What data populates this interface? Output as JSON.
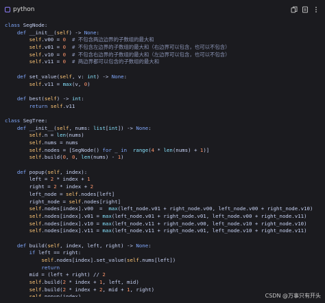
{
  "header": {
    "language": "python",
    "icons": [
      "copy-icon",
      "expand-icon",
      "more-icon"
    ]
  },
  "code": {
    "lines": [
      [
        [
          "kw",
          "class"
        ],
        [
          "t",
          " SegNode:"
        ]
      ],
      [
        [
          "t",
          "    "
        ],
        [
          "kw",
          "def"
        ],
        [
          "t",
          " __init__("
        ],
        [
          "self",
          "self"
        ],
        [
          "t",
          ") -> "
        ],
        [
          "kw",
          "None"
        ],
        [
          "t",
          ":"
        ]
      ],
      [
        [
          "t",
          "        "
        ],
        [
          "self",
          "self"
        ],
        [
          "t",
          ".v00 = "
        ],
        [
          "num",
          "0"
        ],
        [
          "t",
          "  "
        ],
        [
          "cmt",
          "# 不包含两边边界的子数组的最大和"
        ]
      ],
      [
        [
          "t",
          "        "
        ],
        [
          "self",
          "self"
        ],
        [
          "t",
          ".v01 = "
        ],
        [
          "num",
          "0"
        ],
        [
          "t",
          "  "
        ],
        [
          "cmt",
          "# 不包含左边界的子数组的最大和（右边界可以包含，也可以不包含）"
        ]
      ],
      [
        [
          "t",
          "        "
        ],
        [
          "self",
          "self"
        ],
        [
          "t",
          ".v10 = "
        ],
        [
          "num",
          "0"
        ],
        [
          "t",
          "  "
        ],
        [
          "cmt",
          "# 不包含右边界的子数组的最大和（左边界可以包含，也可以不包含）"
        ]
      ],
      [
        [
          "t",
          "        "
        ],
        [
          "self",
          "self"
        ],
        [
          "t",
          ".v11 = "
        ],
        [
          "num",
          "0"
        ],
        [
          "t",
          "  "
        ],
        [
          "cmt",
          "# 两边界都可以包含的子数组的最大和"
        ]
      ],
      [],
      [
        [
          "t",
          "    "
        ],
        [
          "kw",
          "def"
        ],
        [
          "t",
          " set_value("
        ],
        [
          "self",
          "self"
        ],
        [
          "t",
          ", v: "
        ],
        [
          "bi",
          "int"
        ],
        [
          "t",
          ") -> "
        ],
        [
          "kw",
          "None"
        ],
        [
          "t",
          ":"
        ]
      ],
      [
        [
          "t",
          "        "
        ],
        [
          "self",
          "self"
        ],
        [
          "t",
          ".v11 = "
        ],
        [
          "bi",
          "max"
        ],
        [
          "t",
          "(v, "
        ],
        [
          "num",
          "0"
        ],
        [
          "t",
          ")"
        ]
      ],
      [],
      [
        [
          "t",
          "    "
        ],
        [
          "kw",
          "def"
        ],
        [
          "t",
          " best("
        ],
        [
          "self",
          "self"
        ],
        [
          "t",
          ") -> "
        ],
        [
          "bi",
          "int"
        ],
        [
          "t",
          ":"
        ]
      ],
      [
        [
          "t",
          "        "
        ],
        [
          "kw",
          "return"
        ],
        [
          "t",
          " "
        ],
        [
          "self",
          "self"
        ],
        [
          "t",
          ".v11"
        ]
      ],
      [],
      [
        [
          "kw",
          "class"
        ],
        [
          "t",
          " SegTree:"
        ]
      ],
      [
        [
          "t",
          "    "
        ],
        [
          "kw",
          "def"
        ],
        [
          "t",
          " __init__("
        ],
        [
          "self",
          "self"
        ],
        [
          "t",
          ", nums: "
        ],
        [
          "bi",
          "list"
        ],
        [
          "t",
          "["
        ],
        [
          "bi",
          "int"
        ],
        [
          "t",
          "]) -> "
        ],
        [
          "kw",
          "None"
        ],
        [
          "t",
          ":"
        ]
      ],
      [
        [
          "t",
          "        "
        ],
        [
          "self",
          "self"
        ],
        [
          "t",
          ".n = "
        ],
        [
          "bi",
          "len"
        ],
        [
          "t",
          "(nums)"
        ]
      ],
      [
        [
          "t",
          "        "
        ],
        [
          "self",
          "self"
        ],
        [
          "t",
          ".nums = nums"
        ]
      ],
      [
        [
          "t",
          "        "
        ],
        [
          "self",
          "self"
        ],
        [
          "t",
          ".nodes = [SegNode() "
        ],
        [
          "kw",
          "for"
        ],
        [
          "t",
          " _ "
        ],
        [
          "kw",
          "in"
        ],
        [
          "t",
          "  "
        ],
        [
          "bi",
          "range"
        ],
        [
          "t",
          "("
        ],
        [
          "num",
          "4"
        ],
        [
          "t",
          " * "
        ],
        [
          "bi",
          "len"
        ],
        [
          "t",
          "(nums) + "
        ],
        [
          "num",
          "1"
        ],
        [
          "t",
          ")]"
        ]
      ],
      [
        [
          "t",
          "        "
        ],
        [
          "self",
          "self"
        ],
        [
          "t",
          ".build("
        ],
        [
          "num",
          "0"
        ],
        [
          "t",
          ", "
        ],
        [
          "num",
          "0"
        ],
        [
          "t",
          ", "
        ],
        [
          "bi",
          "len"
        ],
        [
          "t",
          "(nums) - "
        ],
        [
          "num",
          "1"
        ],
        [
          "t",
          ")"
        ]
      ],
      [],
      [
        [
          "t",
          "    "
        ],
        [
          "kw",
          "def"
        ],
        [
          "t",
          " popup("
        ],
        [
          "self",
          "self"
        ],
        [
          "t",
          ", index):"
        ]
      ],
      [
        [
          "t",
          "        left = "
        ],
        [
          "num",
          "2"
        ],
        [
          "t",
          " * index + "
        ],
        [
          "num",
          "1"
        ]
      ],
      [
        [
          "t",
          "        right = "
        ],
        [
          "num",
          "2"
        ],
        [
          "t",
          " * index + "
        ],
        [
          "num",
          "2"
        ]
      ],
      [
        [
          "t",
          "        left_node = "
        ],
        [
          "self",
          "self"
        ],
        [
          "t",
          ".nodes[left]"
        ]
      ],
      [
        [
          "t",
          "        right_node = "
        ],
        [
          "self",
          "self"
        ],
        [
          "t",
          ".nodes[right]"
        ]
      ],
      [
        [
          "t",
          "        "
        ],
        [
          "self",
          "self"
        ],
        [
          "t",
          ".nodes[index].v00  =  "
        ],
        [
          "bi",
          "max"
        ],
        [
          "t",
          "(left_node.v01 + right_node.v00, left_node.v00 + right_node.v10)"
        ]
      ],
      [
        [
          "t",
          "        "
        ],
        [
          "self",
          "self"
        ],
        [
          "t",
          ".nodes[index].v01 = "
        ],
        [
          "bi",
          "max"
        ],
        [
          "t",
          "(left_node.v01 + right_node.v01, left_node.v00 + right_node.v11)"
        ]
      ],
      [
        [
          "t",
          "        "
        ],
        [
          "self",
          "self"
        ],
        [
          "t",
          ".nodes[index].v10 = "
        ],
        [
          "bi",
          "max"
        ],
        [
          "t",
          "(left_node.v11 + right_node.v00, left_node.v10 + right_node.v10)"
        ]
      ],
      [
        [
          "t",
          "        "
        ],
        [
          "self",
          "self"
        ],
        [
          "t",
          ".nodes[index].v11 = "
        ],
        [
          "bi",
          "max"
        ],
        [
          "t",
          "(left_node.v11 + right_node.v01, left_node.v10 + right_node.v11)"
        ]
      ],
      [],
      [
        [
          "t",
          "    "
        ],
        [
          "kw",
          "def"
        ],
        [
          "t",
          " build("
        ],
        [
          "self",
          "self"
        ],
        [
          "t",
          ", index, left, right) -> "
        ],
        [
          "kw",
          "None"
        ],
        [
          "t",
          ":"
        ]
      ],
      [
        [
          "t",
          "        "
        ],
        [
          "kw",
          "if"
        ],
        [
          "t",
          " left == right:"
        ]
      ],
      [
        [
          "t",
          "            "
        ],
        [
          "self",
          "self"
        ],
        [
          "t",
          ".nodes[index].set_value("
        ],
        [
          "self",
          "self"
        ],
        [
          "t",
          ".nums[left])"
        ]
      ],
      [
        [
          "t",
          "            "
        ],
        [
          "kw",
          "return"
        ]
      ],
      [
        [
          "t",
          "        mid = (left + right) // "
        ],
        [
          "num",
          "2"
        ]
      ],
      [
        [
          "t",
          "        "
        ],
        [
          "self",
          "self"
        ],
        [
          "t",
          ".build("
        ],
        [
          "num",
          "2"
        ],
        [
          "t",
          " * index + "
        ],
        [
          "num",
          "1"
        ],
        [
          "t",
          ", left, mid)"
        ]
      ],
      [
        [
          "t",
          "        "
        ],
        [
          "self",
          "self"
        ],
        [
          "t",
          ".build("
        ],
        [
          "num",
          "2"
        ],
        [
          "t",
          " * index + "
        ],
        [
          "num",
          "2"
        ],
        [
          "t",
          ", mid + "
        ],
        [
          "num",
          "1"
        ],
        [
          "t",
          ", right)"
        ]
      ],
      [
        [
          "t",
          "        "
        ],
        [
          "self",
          "self"
        ],
        [
          "t",
          ".popup(index)"
        ]
      ]
    ]
  },
  "watermark": "CSDN @万事只有开头",
  "colors": {
    "background": "#1b1b1f",
    "keyword": "#82aaff",
    "self": "#ffc777",
    "builtin": "#86e1fc",
    "number": "#ff966c",
    "comment": "#8a93b4",
    "text": "#c8d3f5"
  }
}
